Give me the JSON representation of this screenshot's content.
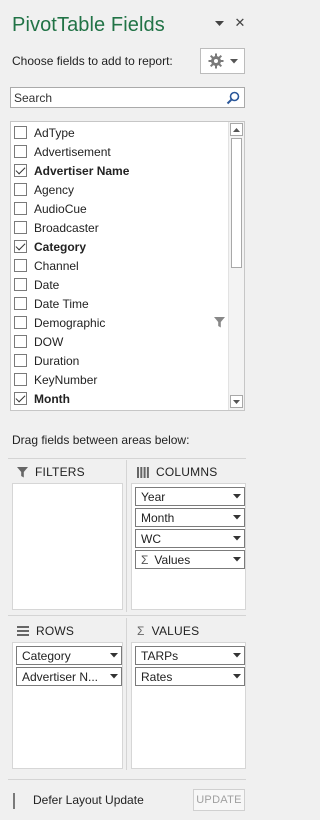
{
  "panel": {
    "title": "PivotTable Fields",
    "choose_label": "Choose fields to add to report:",
    "close_glyph": "✕"
  },
  "search": {
    "placeholder": "Search"
  },
  "fields": [
    {
      "label": "AdType",
      "checked": false
    },
    {
      "label": "Advertisement",
      "checked": false
    },
    {
      "label": "Advertiser Name",
      "checked": true
    },
    {
      "label": "Agency",
      "checked": false
    },
    {
      "label": "AudioCue",
      "checked": false
    },
    {
      "label": "Broadcaster",
      "checked": false
    },
    {
      "label": "Category",
      "checked": true
    },
    {
      "label": "Channel",
      "checked": false
    },
    {
      "label": "Date",
      "checked": false
    },
    {
      "label": "Date Time",
      "checked": false
    },
    {
      "label": "Demographic",
      "checked": false,
      "filtered": true
    },
    {
      "label": "DOW",
      "checked": false
    },
    {
      "label": "Duration",
      "checked": false
    },
    {
      "label": "KeyNumber",
      "checked": false
    },
    {
      "label": "Month",
      "checked": true
    }
  ],
  "areas": {
    "drag_text": "Drag fields between areas below:",
    "filters": {
      "title": "FILTERS",
      "items": []
    },
    "columns": {
      "title": "COLUMNS",
      "items": [
        "Year",
        "Month",
        "WC",
        "Values"
      ]
    },
    "rows": {
      "title": "ROWS",
      "items": [
        "Category",
        "Advertiser N..."
      ]
    },
    "values": {
      "title": "VALUES",
      "items": [
        "TARPs",
        "Rates"
      ]
    }
  },
  "footer": {
    "defer_label": "Defer Layout Update",
    "defer_checked": false,
    "update_label": "UPDATE"
  },
  "colors": {
    "title": "#217346"
  }
}
